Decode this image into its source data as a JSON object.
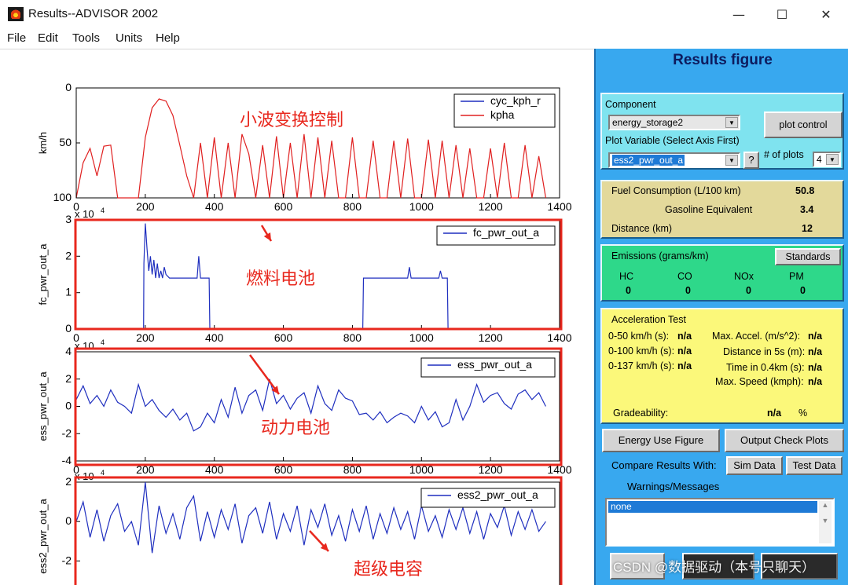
{
  "window": {
    "title": "Results--ADVISOR 2002",
    "minimize_glyph": "—",
    "maximize_glyph": "☐",
    "close_glyph": "✕"
  },
  "menu": [
    "File",
    "Edit",
    "Tools",
    "Units",
    "Help"
  ],
  "plots": {
    "x_ticks": [
      "0",
      "200",
      "400",
      "600",
      "800",
      "1000",
      "1200",
      "1400"
    ],
    "exponent_label": "x 10",
    "exponent_sup": "4",
    "panels": [
      {
        "ylabel": "km/h",
        "y_ticks": [
          "100",
          "50",
          "0"
        ],
        "legend": [
          "cyc_kph_r",
          "kpha"
        ],
        "annotation": "小波变换控制"
      },
      {
        "ylabel": "fc_pwr_out_a",
        "y_ticks": [
          "3",
          "2",
          "1",
          "0"
        ],
        "legend": [
          "fc_pwr_out_a"
        ],
        "annotation": "燃料电池"
      },
      {
        "ylabel": "ess_pwr_out_a",
        "y_ticks": [
          "4",
          "2",
          "0",
          "-2",
          "-4"
        ],
        "legend": [
          "ess_pwr_out_a"
        ],
        "annotation": "动力电池"
      },
      {
        "ylabel": "ess2_pwr_out_a",
        "y_ticks": [
          "2",
          "0",
          "-2"
        ],
        "legend": [
          "ess2_pwr_out_a"
        ],
        "annotation": "超级电容"
      }
    ]
  },
  "chart_data": [
    {
      "type": "line",
      "xlabel": "",
      "ylabel": "km/h",
      "xlim": [
        0,
        1400
      ],
      "ylim": [
        0,
        100
      ],
      "series": [
        {
          "name": "cyc_kph_r",
          "color": "#1f2fbf",
          "x": [],
          "y": []
        },
        {
          "name": "kpha",
          "color": "#e02020",
          "x": [
            0,
            20,
            40,
            60,
            80,
            100,
            120,
            140,
            160,
            180,
            200,
            220,
            240,
            260,
            280,
            300,
            320,
            340,
            360,
            380,
            400,
            420,
            440,
            460,
            480,
            500,
            520,
            540,
            560,
            580,
            600,
            620,
            640,
            660,
            680,
            700,
            720,
            740,
            760,
            780,
            800,
            820,
            840,
            860,
            880,
            900,
            920,
            940,
            960,
            980,
            1000,
            1020,
            1040,
            1060,
            1080,
            1100,
            1120,
            1140,
            1160,
            1180,
            1200,
            1220,
            1240,
            1260,
            1280,
            1300,
            1320,
            1340,
            1360
          ],
          "y": [
            0,
            32,
            45,
            20,
            47,
            48,
            0,
            0,
            0,
            0,
            55,
            82,
            90,
            88,
            75,
            48,
            20,
            0,
            50,
            0,
            55,
            0,
            50,
            0,
            58,
            40,
            0,
            48,
            0,
            56,
            0,
            50,
            0,
            58,
            0,
            55,
            0,
            52,
            0,
            0,
            55,
            0,
            0,
            52,
            0,
            0,
            52,
            0,
            54,
            0,
            0,
            53,
            0,
            52,
            0,
            48,
            0,
            45,
            0,
            0,
            45,
            0,
            50,
            0,
            0,
            48,
            0,
            38,
            0
          ]
        }
      ]
    },
    {
      "type": "line",
      "ylabel": "fc_pwr_out_a",
      "xlim": [
        0,
        1400
      ],
      "ylim": [
        0,
        3
      ],
      "exponent": "x 10^4",
      "series": [
        {
          "name": "fc_pwr_out_a",
          "color": "#1f2fbf",
          "x": [
            0,
            195,
            196,
            200,
            205,
            210,
            215,
            220,
            225,
            230,
            235,
            240,
            245,
            250,
            255,
            260,
            270,
            290,
            320,
            350,
            355,
            360,
            365,
            385,
            387,
            830,
            832,
            900,
            960,
            965,
            970,
            1050,
            1055,
            1060,
            1075,
            1077,
            1400
          ],
          "y": [
            0,
            0,
            1.8,
            2.9,
            2.2,
            1.6,
            2.0,
            1.5,
            1.9,
            1.4,
            1.8,
            1.4,
            1.6,
            1.4,
            1.7,
            1.5,
            1.4,
            1.4,
            1.4,
            1.4,
            2.0,
            1.4,
            1.4,
            1.4,
            0,
            0,
            1.4,
            1.4,
            1.4,
            1.7,
            1.4,
            1.4,
            1.6,
            1.4,
            1.4,
            0,
            0
          ]
        }
      ]
    },
    {
      "type": "line",
      "ylabel": "ess_pwr_out_a",
      "xlim": [
        0,
        1400
      ],
      "ylim": [
        -4,
        4
      ],
      "exponent": "x 10^4",
      "series": [
        {
          "name": "ess_pwr_out_a",
          "color": "#1f2fbf",
          "x": [
            0,
            20,
            40,
            60,
            80,
            100,
            120,
            140,
            160,
            180,
            200,
            220,
            240,
            260,
            280,
            300,
            320,
            340,
            360,
            380,
            400,
            420,
            440,
            460,
            480,
            500,
            520,
            540,
            560,
            580,
            600,
            620,
            640,
            660,
            680,
            700,
            720,
            740,
            760,
            780,
            800,
            820,
            840,
            860,
            880,
            900,
            920,
            940,
            960,
            980,
            1000,
            1020,
            1040,
            1060,
            1080,
            1100,
            1120,
            1140,
            1160,
            1180,
            1200,
            1220,
            1240,
            1260,
            1280,
            1300,
            1320,
            1340,
            1360
          ],
          "y": [
            0.5,
            1.5,
            0.2,
            0.8,
            0,
            1.2,
            0.3,
            0,
            -0.5,
            1.6,
            0,
            0.5,
            -0.3,
            -0.8,
            -0.2,
            -1.0,
            -0.5,
            -1.8,
            -1.5,
            -0.5,
            -1.2,
            0.5,
            -0.8,
            1.4,
            -0.5,
            0.8,
            1.2,
            -0.3,
            2.0,
            0.2,
            0.8,
            -0.2,
            0.6,
            1.0,
            -0.5,
            1.5,
            0.2,
            -0.3,
            1.2,
            0.6,
            0.4,
            -0.6,
            -0.5,
            -1.0,
            -0.4,
            -1.2,
            -0.8,
            -0.5,
            -0.7,
            -1.2,
            0,
            -1.0,
            -0.4,
            -1.5,
            -1.2,
            0.5,
            -1.0,
            0,
            1.6,
            0.3,
            0.8,
            1.0,
            0.2,
            -0.2,
            0.9,
            1.2,
            0.5,
            1.0,
            0
          ]
        }
      ]
    },
    {
      "type": "line",
      "ylabel": "ess2_pwr_out_a",
      "xlim": [
        0,
        1400
      ],
      "ylim": [
        -3.5,
        2
      ],
      "exponent": "x 10^4",
      "series": [
        {
          "name": "ess2_pwr_out_a",
          "color": "#1f2fbf",
          "x": [
            0,
            20,
            40,
            60,
            80,
            100,
            120,
            140,
            160,
            180,
            200,
            220,
            240,
            260,
            280,
            300,
            320,
            340,
            360,
            380,
            400,
            420,
            440,
            460,
            480,
            500,
            520,
            540,
            560,
            580,
            600,
            620,
            640,
            660,
            680,
            700,
            720,
            740,
            760,
            780,
            800,
            820,
            840,
            860,
            880,
            900,
            920,
            940,
            960,
            980,
            1000,
            1020,
            1040,
            1060,
            1080,
            1100,
            1120,
            1140,
            1160,
            1180,
            1200,
            1220,
            1240,
            1260,
            1280,
            1300,
            1320,
            1340,
            1360
          ],
          "y": [
            0,
            1.0,
            -0.8,
            0.6,
            -1.0,
            0.3,
            0.9,
            -0.5,
            0,
            -1.2,
            2.0,
            -1.6,
            0.8,
            -0.6,
            0.4,
            -0.9,
            0.7,
            1.3,
            -1.0,
            0.5,
            -0.8,
            0.6,
            -0.4,
            0.9,
            -1.1,
            0.3,
            0.7,
            -0.6,
            1.0,
            -0.9,
            0.4,
            -0.5,
            0.8,
            -1.2,
            0.6,
            -0.3,
            0.9,
            -0.7,
            0.3,
            -1.0,
            0.6,
            -0.5,
            0.8,
            -0.9,
            0.4,
            -0.6,
            0.7,
            -0.4,
            0.5,
            -0.9,
            0.8,
            -0.5,
            0.3,
            -0.8,
            0.6,
            -0.4,
            0.7,
            -0.6,
            0.5,
            -0.9,
            0.4,
            -0.3,
            0.8,
            -0.7,
            0.5,
            -0.4,
            0.6,
            -0.5,
            0
          ]
        }
      ]
    }
  ],
  "panel": {
    "title": "Results figure",
    "component_label": "Component",
    "component_value": "energy_storage2",
    "plot_control_label": "plot control",
    "plot_variable_label": "Plot Variable (Select Axis First)",
    "plot_variable_value": "ess2_pwr_out_a",
    "help_button": "?",
    "num_plots_label": "# of plots",
    "num_plots_value": "4",
    "fuel": {
      "consumption_label": "Fuel Consumption (L/100 km)",
      "consumption_value": "50.8",
      "gas_equiv_label": "Gasoline Equivalent",
      "gas_equiv_value": "3.4",
      "distance_label": "Distance (km)",
      "distance_value": "12"
    },
    "emissions": {
      "title": "Emissions (grams/km)",
      "standards_button": "Standards",
      "names": [
        "HC",
        "CO",
        "NOx",
        "PM"
      ],
      "values": [
        "0",
        "0",
        "0",
        "0"
      ]
    },
    "acceleration": {
      "title": "Acceleration Test",
      "rows_left": [
        {
          "label": "0-50 km/h (s):",
          "value": "n/a"
        },
        {
          "label": "0-100 km/h (s):",
          "value": "n/a"
        },
        {
          "label": "0-137 km/h (s):",
          "value": "n/a"
        }
      ],
      "rows_right": [
        {
          "label": "Max. Accel. (m/s^2):",
          "value": "n/a"
        },
        {
          "label": "Distance in 5s (m):",
          "value": "n/a"
        },
        {
          "label": "Time in 0.4km (s):",
          "value": "n/a"
        },
        {
          "label": "Max. Speed (kmph):",
          "value": "n/a"
        }
      ],
      "grade_label": "Gradeability:",
      "grade_value": "n/a",
      "grade_unit": "%"
    },
    "energy_use_button": "Energy Use Figure",
    "output_check_button": "Output Check Plots",
    "compare_label": "Compare Results With:",
    "sim_data_button": "Sim Data",
    "test_data_button": "Test Data",
    "warnings_label": "Warnings/Messages",
    "warnings_selected": "none"
  },
  "watermark": "CSDN @数据驱动（本号只聊天）"
}
